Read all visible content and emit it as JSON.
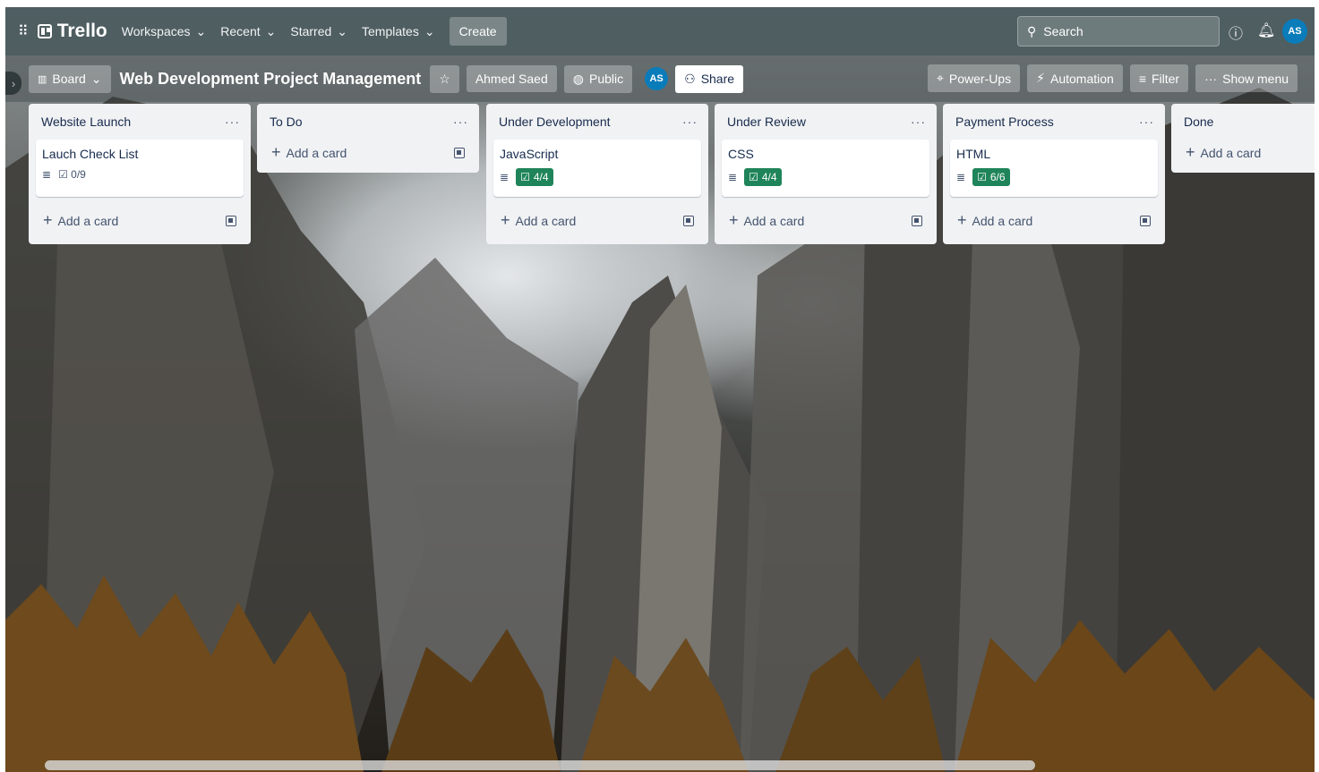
{
  "topbar": {
    "logo": "Trello",
    "menus": [
      "Workspaces",
      "Recent",
      "Starred",
      "Templates"
    ],
    "create": "Create",
    "search_placeholder": "Search",
    "avatar": "AS"
  },
  "board": {
    "view": "Board",
    "title": "Web Development Project Management",
    "owner": "Ahmed Saed",
    "visibility": "Public",
    "member_avatar": "AS",
    "share": "Share",
    "powerups": "Power-Ups",
    "automation": "Automation",
    "filter": "Filter",
    "show_menu": "Show menu"
  },
  "lists": [
    {
      "title": "Website Launch",
      "cards": [
        {
          "title": "Lauch Check List",
          "checklist": "0/9",
          "complete": false
        }
      ],
      "add": "Add a card"
    },
    {
      "title": "To Do",
      "cards": [],
      "add": "Add a card"
    },
    {
      "title": "Under Development",
      "cards": [
        {
          "title": "JavaScript",
          "checklist": "4/4",
          "complete": true
        }
      ],
      "add": "Add a card"
    },
    {
      "title": "Under Review",
      "cards": [
        {
          "title": "CSS",
          "checklist": "4/4",
          "complete": true
        }
      ],
      "add": "Add a card"
    },
    {
      "title": "Payment Process",
      "cards": [
        {
          "title": "HTML",
          "checklist": "6/6",
          "complete": true
        }
      ],
      "add": "Add a card"
    },
    {
      "title": "Done",
      "cards": [],
      "add": "Add a card"
    }
  ],
  "colors": {
    "accent": "#0a7cba",
    "complete_badge": "#1f845a",
    "list_bg": "#f1f2f4"
  }
}
